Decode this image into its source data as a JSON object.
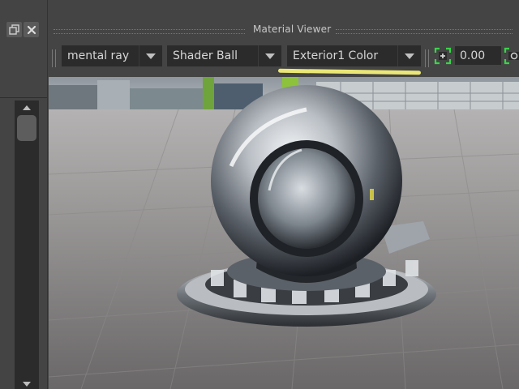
{
  "window": {
    "title": "Material Viewer"
  },
  "toolbar": {
    "renderer": {
      "value": "mental ray"
    },
    "geometry": {
      "value": "Shader Ball"
    },
    "environment": {
      "value": "Exterior1 Color"
    },
    "exposure_value": "0.00"
  },
  "icons": {
    "dock_float": "float-window-icon",
    "dock_close": "close-icon",
    "exposure": "exposure-icon",
    "gamma": "gamma-icon"
  },
  "colors": {
    "panel_bg": "#444444",
    "field_bg": "#2b2b2b",
    "accent_green": "#3bd34a",
    "annotation_yellow": "#f4f07a"
  }
}
